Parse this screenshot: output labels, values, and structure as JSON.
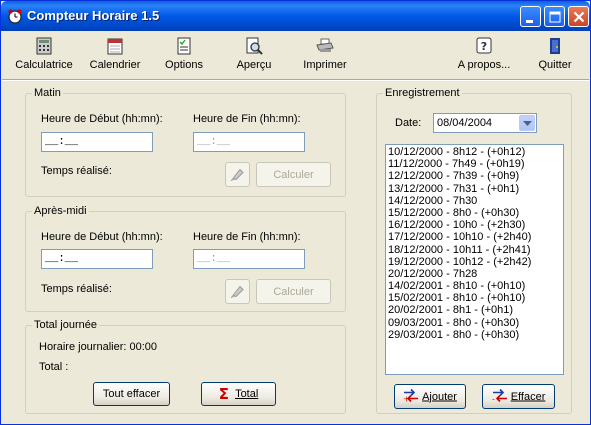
{
  "window": {
    "title": "Compteur Horaire 1.5",
    "controls": [
      "minimize",
      "maximize",
      "close"
    ]
  },
  "toolbar": {
    "items": [
      {
        "label": "Calculatrice",
        "icon": "calculator-icon"
      },
      {
        "label": "Calendrier",
        "icon": "calendar-icon"
      },
      {
        "label": "Options",
        "icon": "options-checklist-icon"
      },
      {
        "label": "Aperçu",
        "icon": "print-preview-icon"
      },
      {
        "label": "Imprimer",
        "icon": "printer-icon"
      },
      {
        "label": "A propos...",
        "icon": "help-question-icon"
      },
      {
        "label": "Quitter",
        "icon": "exit-door-icon"
      }
    ]
  },
  "matin": {
    "legend": "Matin",
    "start_label": "Heure de Début (hh:mn):",
    "end_label": "Heure de Fin (hh:mn):",
    "start_value": "__:__",
    "end_value": "__:__",
    "result_label": "Temps réalisé:",
    "calc_button": "Calculer"
  },
  "apresmidi": {
    "legend": "Après-midi",
    "start_label": "Heure de Début (hh:mn):",
    "end_label": "Heure de Fin (hh:mn):",
    "start_value": "__:__",
    "end_value": "__:__",
    "result_label": "Temps réalisé:",
    "calc_button": "Calculer"
  },
  "total": {
    "legend": "Total journée",
    "horaire_label": "Horaire journalier: 00:00",
    "total_label": "Total :",
    "clear_button": "Tout effacer",
    "total_button": "Total"
  },
  "enregistrement": {
    "legend": "Enregistrement",
    "date_label": "Date:",
    "date_value": "08/04/2004",
    "entries": [
      "10/12/2000 - 8h12 - (+0h12)",
      "11/12/2000 - 7h49 - (+0h19)",
      "12/12/2000 - 7h39 - (+0h9)",
      "13/12/2000 - 7h31 - (+0h1)",
      "14/12/2000 - 7h30",
      "15/12/2000 - 8h0 - (+0h30)",
      "16/12/2000 - 10h0 - (+2h30)",
      "17/12/2000 - 10h10 - (+2h40)",
      "18/12/2000 - 10h11 - (+2h41)",
      "19/12/2000 - 10h12 - (+2h42)",
      "20/12/2000 - 7h28",
      "14/02/2001 - 8h10 - (+0h10)",
      "15/02/2001 - 8h10 - (+0h10)",
      "20/02/2001 - 8h1 - (+0h1)",
      "09/03/2001 - 8h0 - (+0h30)",
      "29/03/2001 - 8h0 - (+0h30)"
    ],
    "add_button": "Ajouter",
    "delete_button": "Effacer"
  }
}
